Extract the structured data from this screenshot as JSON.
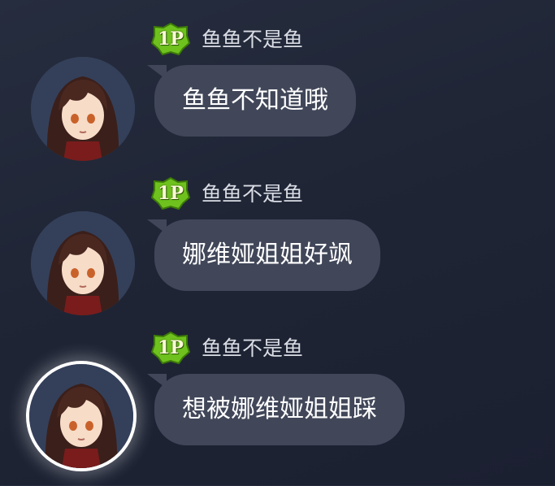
{
  "messages": [
    {
      "badge": "1P",
      "sender": "鱼鱼不是鱼",
      "text": "鱼鱼不知道哦",
      "selected": false
    },
    {
      "badge": "1P",
      "sender": "鱼鱼不是鱼",
      "text": "娜维娅姐姐好飒",
      "selected": false
    },
    {
      "badge": "1P",
      "sender": "鱼鱼不是鱼",
      "text": "想被娜维娅姐姐踩",
      "selected": true
    }
  ],
  "colors": {
    "background": "#1f2535",
    "bubble": "#414759",
    "badge_green": "#6fc21e",
    "name_text": "#d9dce4"
  },
  "icons": {
    "badge": "player-1p-badge-icon",
    "avatar": "character-avatar"
  }
}
